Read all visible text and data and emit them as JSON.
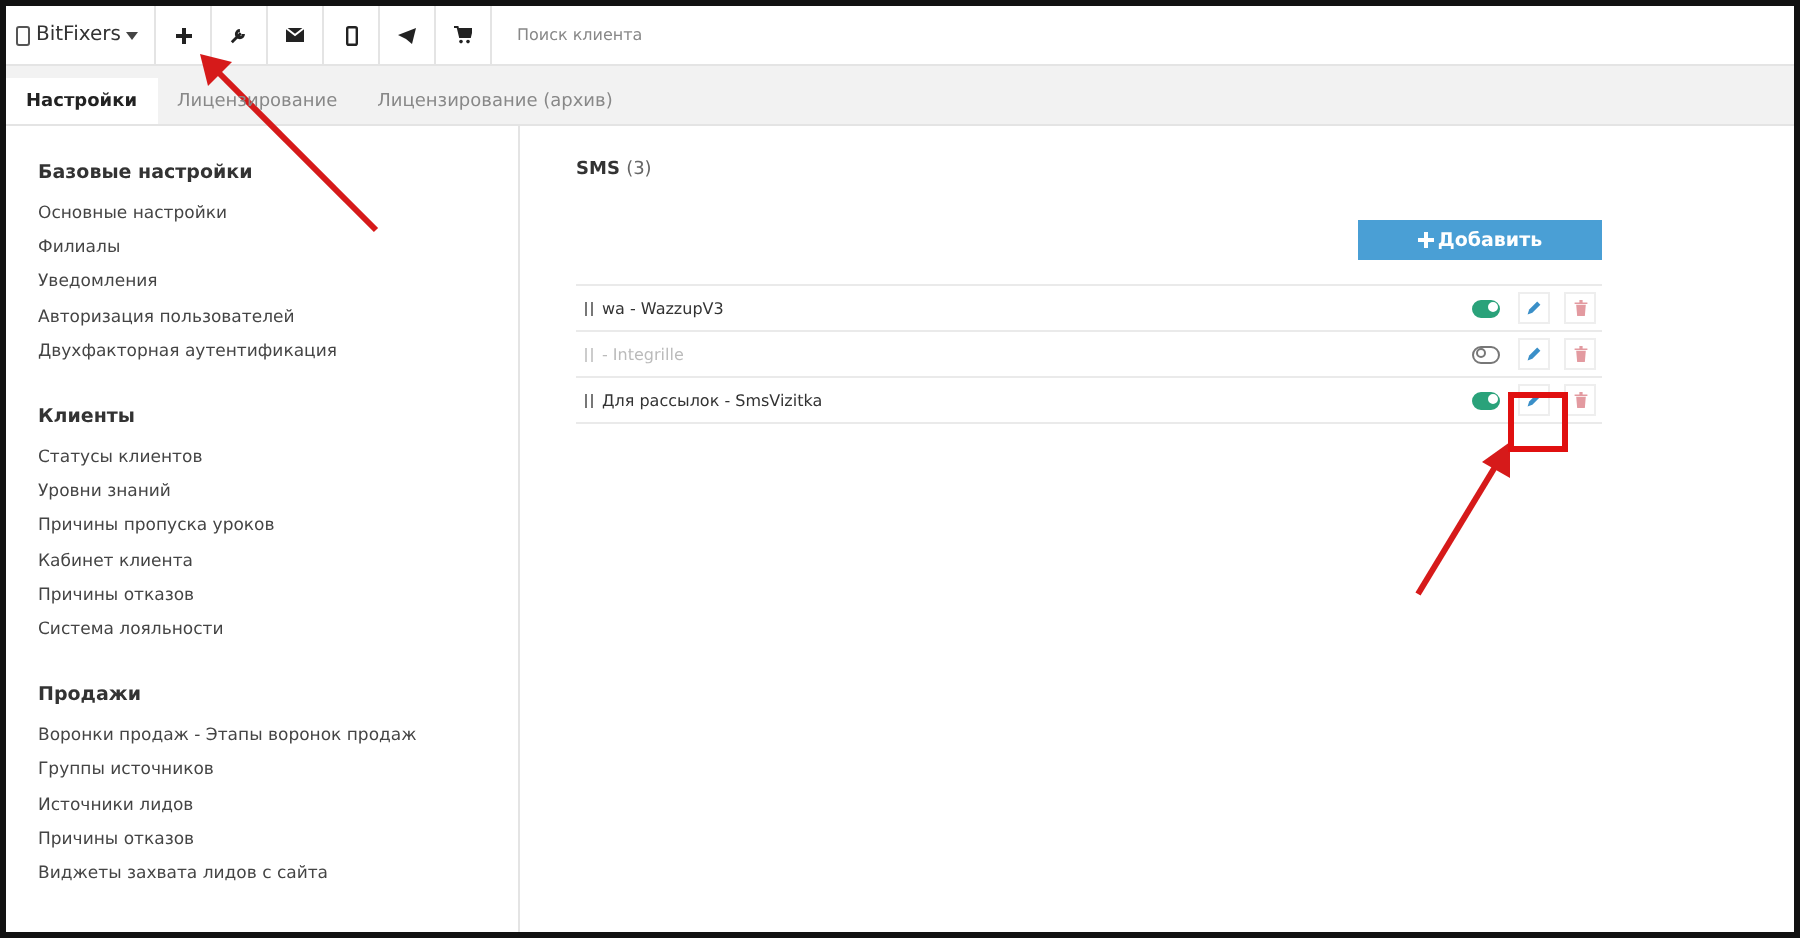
{
  "topbar": {
    "brand": "BitFixers",
    "search": {
      "placeholder": "Поиск клиента"
    }
  },
  "tabs": [
    {
      "label": "Настройки",
      "selected": true
    },
    {
      "label": "Лицензирование",
      "selected": false
    },
    {
      "label": "Лицензирование (архив)",
      "selected": false
    }
  ],
  "sidebar": {
    "sections": [
      {
        "title": "Базовые настройки",
        "items": [
          "Основные настройки",
          "Филиалы",
          "Уведомления",
          "Авторизация пользователей",
          "Двухфакторная аутентификация"
        ]
      },
      {
        "title": "Клиенты",
        "items": [
          "Статусы клиентов",
          "Уровни знаний",
          "Причины пропуска уроков",
          "Кабинет клиента",
          "Причины отказов",
          "Система лояльности"
        ]
      },
      {
        "title": "Продажи",
        "items": [
          "Воронки продаж - Этапы воронок продаж",
          "Группы источников",
          "Источники лидов",
          "Причины отказов",
          "Виджеты захвата лидов с сайта"
        ]
      }
    ]
  },
  "content": {
    "title": "SMS",
    "count": "(3)",
    "add_button": "Добавить",
    "rows": [
      {
        "name": "wa - WazzupV3",
        "on": true
      },
      {
        "name": "- Integrille",
        "on": false
      },
      {
        "name": "Для рассылок - SmsVizitka",
        "on": true
      }
    ]
  }
}
